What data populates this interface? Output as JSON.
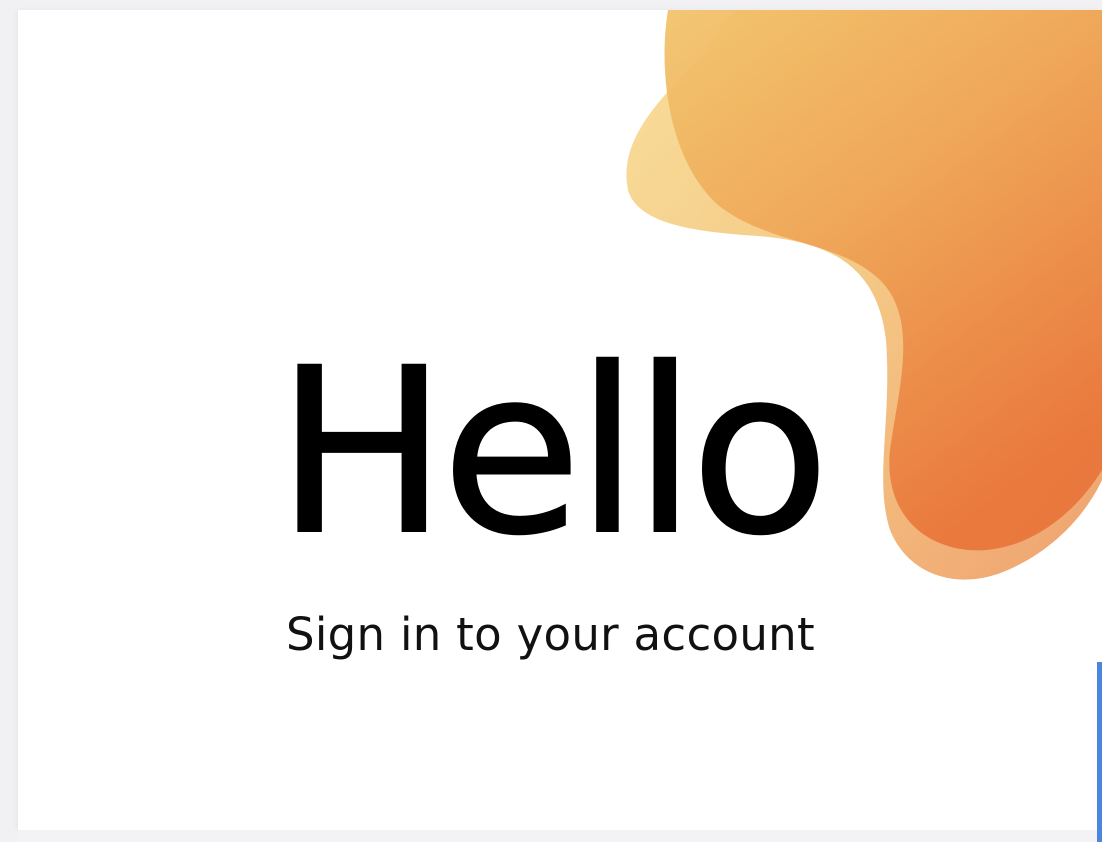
{
  "login": {
    "heading": "Hello",
    "subtitle": "Sign in to your account"
  },
  "colors": {
    "blob_light": "#f6d98c",
    "blob_mid": "#f0b05e",
    "blob_dark": "#ea7d3c",
    "edge_accent": "#4a86e0"
  }
}
